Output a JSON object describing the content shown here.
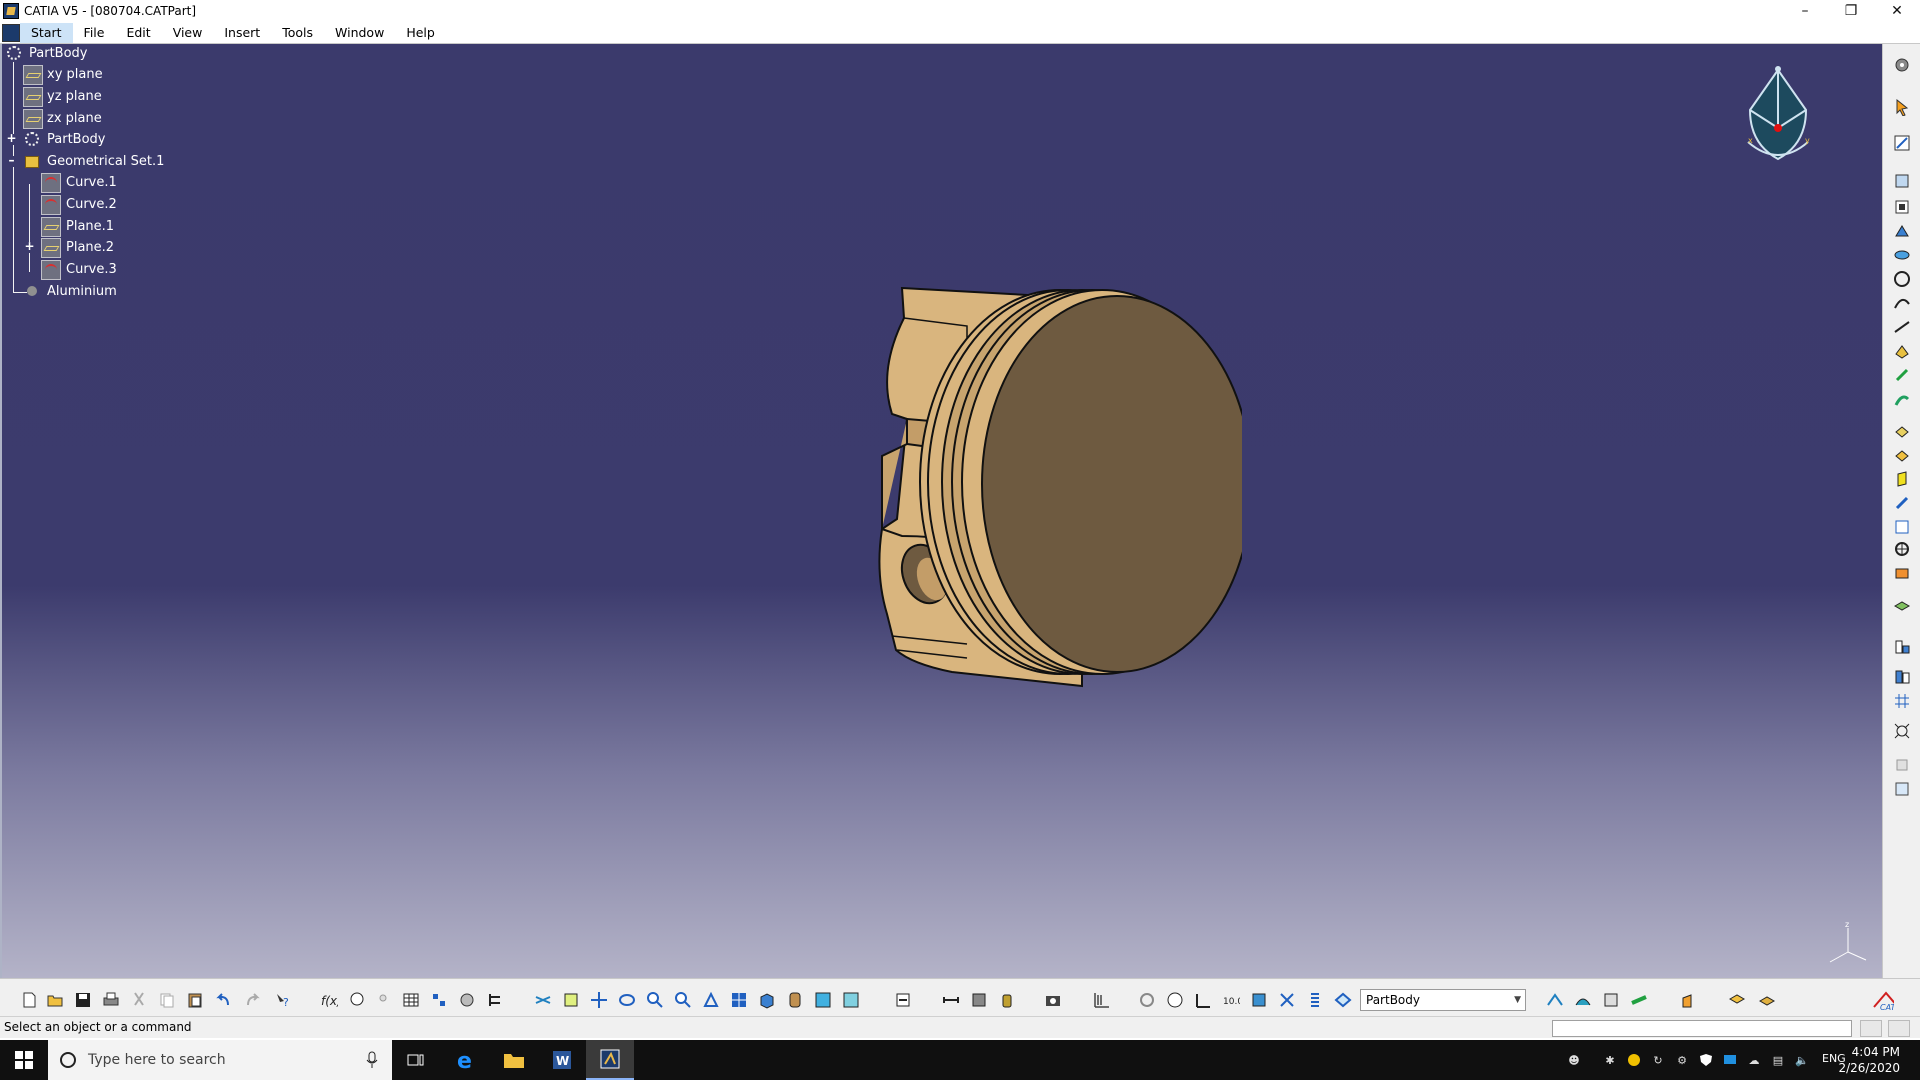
{
  "window": {
    "title": "CATIA V5 - [080704.CATPart]"
  },
  "menu": [
    "Start",
    "File",
    "Edit",
    "View",
    "Insert",
    "Tools",
    "Window",
    "Help"
  ],
  "tree": {
    "root": "PartBody",
    "nodes": [
      "xy plane",
      "yz plane",
      "zx plane",
      "PartBody",
      "Geometrical Set.1",
      "Curve.1",
      "Curve.2",
      "Plane.1",
      "Plane.2",
      "Curve.3",
      "Aluminium"
    ]
  },
  "toolbar": {
    "current_body": "PartBody"
  },
  "status": {
    "message": "Select an object or a command"
  },
  "taskbar": {
    "search_placeholder": "Type here to search",
    "lang": "ENG",
    "time": "4:04 PM",
    "date": "2/26/2020"
  },
  "compass": {
    "z_label": "z"
  },
  "colors": {
    "viewport_top": "#3b3a6c",
    "viewport_bottom": "#b4b3c8",
    "part_color": "#d9b57e",
    "part_face": "#6e5a40"
  }
}
